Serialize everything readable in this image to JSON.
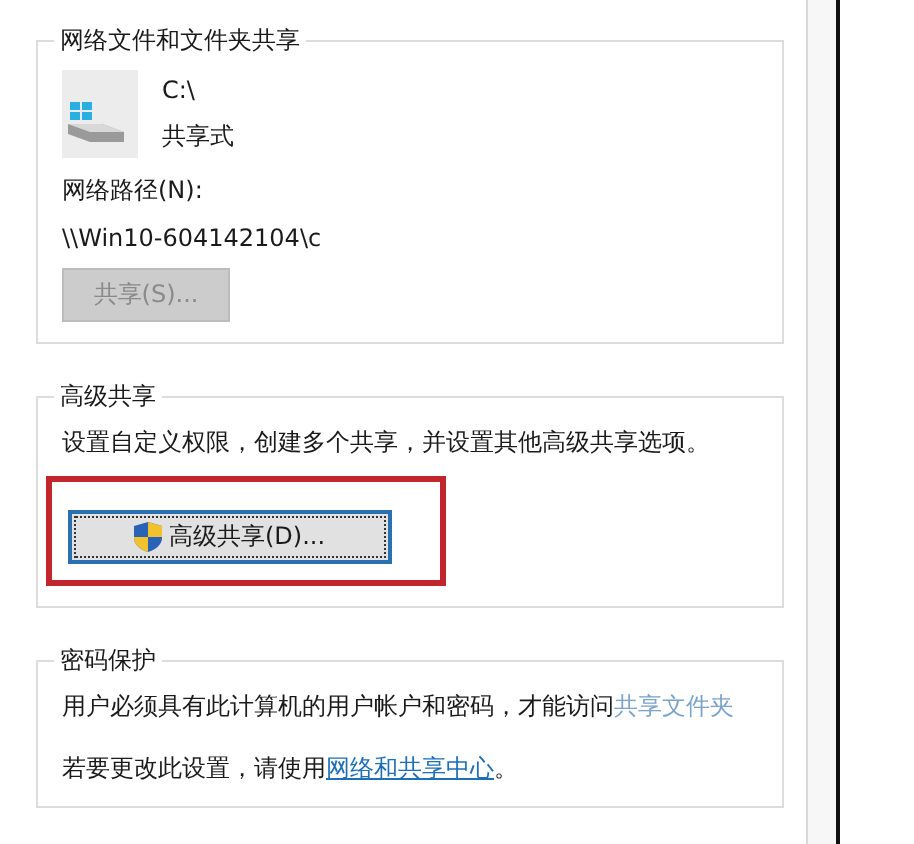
{
  "network_sharing": {
    "title": "网络文件和文件夹共享",
    "drive_name": "C:\\",
    "share_state": "共享式",
    "path_label": "网络路径(N):",
    "path_value": "\\\\Win10-604142104\\c",
    "share_button": {
      "label": "共享(S)...",
      "disabled": true
    }
  },
  "advanced_sharing": {
    "title": "高级共享",
    "description": "设置自定义权限，创建多个共享，并设置其他高级共享选项。",
    "button": {
      "label": "高级共享(D)...",
      "focused": true,
      "highlighted": true
    }
  },
  "password_protection": {
    "title": "密码保护",
    "text": "用户必须具有此计算机的用户帐户和密码，才能访问",
    "text_link": "共享文件夹",
    "change_text": "若要更改此设置，请使用",
    "change_link": "网络和共享中心",
    "change_end": "。"
  }
}
